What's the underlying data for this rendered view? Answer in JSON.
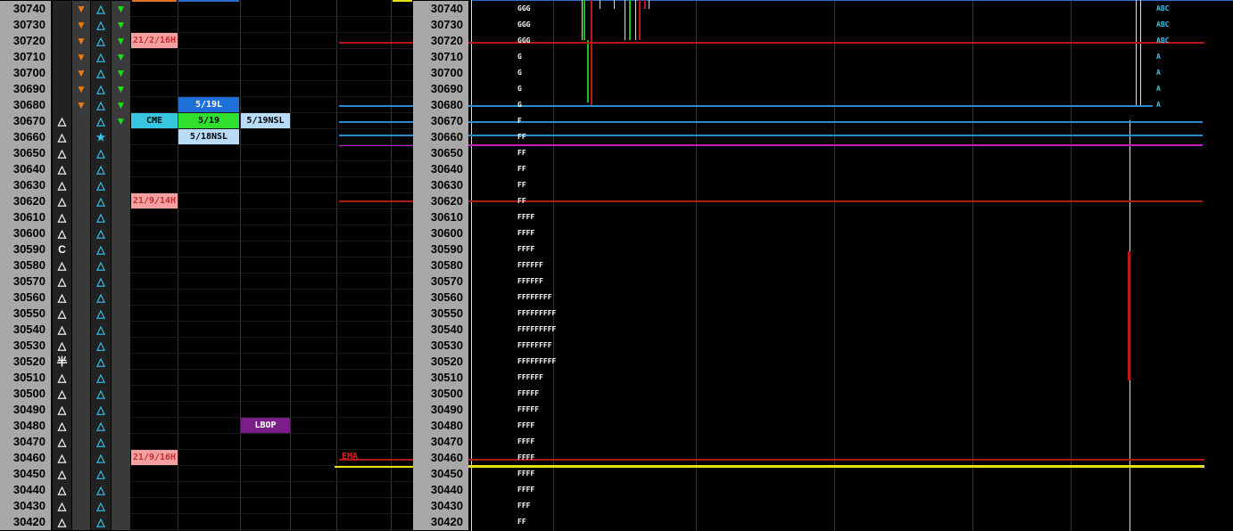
{
  "rows": [
    {
      "price": "30740",
      "left_icon": "",
      "left_color": "",
      "mid_icon": "▼",
      "mid_color": "#f07a12",
      "tri": "△",
      "tri_color": "#38c6f0",
      "right_icon": "▼",
      "right_color": "#19e01c",
      "tpo": "GGG",
      "abc": "ABC"
    },
    {
      "price": "30730",
      "left_icon": "",
      "left_color": "",
      "mid_icon": "▼",
      "mid_color": "#f07a12",
      "tri": "△",
      "tri_color": "#38c6f0",
      "right_icon": "▼",
      "right_color": "#19e01c",
      "tpo": "GGG",
      "abc": "ABC"
    },
    {
      "price": "30720",
      "left_icon": "",
      "left_color": "",
      "mid_icon": "▼",
      "mid_color": "#f07a12",
      "tri": "△",
      "tri_color": "#38c6f0",
      "right_icon": "▼",
      "right_color": "#19e01c",
      "tpo": "GGG",
      "abc": "ABC"
    },
    {
      "price": "30710",
      "left_icon": "",
      "left_color": "",
      "mid_icon": "▼",
      "mid_color": "#f07a12",
      "tri": "△",
      "tri_color": "#38c6f0",
      "right_icon": "▼",
      "right_color": "#19e01c",
      "tpo": "G",
      "abc": "A"
    },
    {
      "price": "30700",
      "left_icon": "",
      "left_color": "",
      "mid_icon": "▼",
      "mid_color": "#f07a12",
      "tri": "△",
      "tri_color": "#38c6f0",
      "right_icon": "▼",
      "right_color": "#19e01c",
      "tpo": "G",
      "abc": "A"
    },
    {
      "price": "30690",
      "left_icon": "",
      "left_color": "",
      "mid_icon": "▼",
      "mid_color": "#f07a12",
      "tri": "△",
      "tri_color": "#38c6f0",
      "right_icon": "▼",
      "right_color": "#19e01c",
      "tpo": "G",
      "abc": "A"
    },
    {
      "price": "30680",
      "left_icon": "",
      "left_color": "",
      "mid_icon": "▼",
      "mid_color": "#f07a12",
      "tri": "△",
      "tri_color": "#38c6f0",
      "right_icon": "▼",
      "right_color": "#19e01c",
      "tpo": "G",
      "abc": "A"
    },
    {
      "price": "30670",
      "left_icon": "△",
      "left_color": "#ffffff",
      "mid_icon": "",
      "mid_color": "",
      "tri": "△",
      "tri_color": "#38c6f0",
      "right_icon": "▼",
      "right_color": "#19e01c",
      "tpo": "F",
      "abc": ""
    },
    {
      "price": "30660",
      "left_icon": "△",
      "left_color": "#ffffff",
      "mid_icon": "",
      "mid_color": "",
      "tri": "★",
      "tri_color": "#38c6f0",
      "right_icon": "",
      "right_color": "",
      "tpo": "FF",
      "abc": ""
    },
    {
      "price": "30650",
      "left_icon": "△",
      "left_color": "#ffffff",
      "mid_icon": "",
      "mid_color": "",
      "tri": "△",
      "tri_color": "#38c6f0",
      "right_icon": "",
      "right_color": "",
      "tpo": "FF",
      "abc": ""
    },
    {
      "price": "30640",
      "left_icon": "△",
      "left_color": "#ffffff",
      "mid_icon": "",
      "mid_color": "",
      "tri": "△",
      "tri_color": "#38c6f0",
      "right_icon": "",
      "right_color": "",
      "tpo": "FF",
      "abc": ""
    },
    {
      "price": "30630",
      "left_icon": "△",
      "left_color": "#ffffff",
      "mid_icon": "",
      "mid_color": "",
      "tri": "△",
      "tri_color": "#38c6f0",
      "right_icon": "",
      "right_color": "",
      "tpo": "FF",
      "abc": ""
    },
    {
      "price": "30620",
      "left_icon": "△",
      "left_color": "#ffffff",
      "mid_icon": "",
      "mid_color": "",
      "tri": "△",
      "tri_color": "#38c6f0",
      "right_icon": "",
      "right_color": "",
      "tpo": "FF",
      "abc": ""
    },
    {
      "price": "30610",
      "left_icon": "△",
      "left_color": "#ffffff",
      "mid_icon": "",
      "mid_color": "",
      "tri": "△",
      "tri_color": "#38c6f0",
      "right_icon": "",
      "right_color": "",
      "tpo": "FFFF",
      "abc": ""
    },
    {
      "price": "30600",
      "left_icon": "△",
      "left_color": "#ffffff",
      "mid_icon": "",
      "mid_color": "",
      "tri": "△",
      "tri_color": "#38c6f0",
      "right_icon": "",
      "right_color": "",
      "tpo": "FFFF",
      "abc": ""
    },
    {
      "price": "30590",
      "left_icon": "C",
      "left_color": "#ffffff",
      "mid_icon": "",
      "mid_color": "",
      "tri": "△",
      "tri_color": "#38c6f0",
      "right_icon": "",
      "right_color": "",
      "tpo": "FFFF",
      "abc": ""
    },
    {
      "price": "30580",
      "left_icon": "△",
      "left_color": "#ffffff",
      "mid_icon": "",
      "mid_color": "",
      "tri": "△",
      "tri_color": "#38c6f0",
      "right_icon": "",
      "right_color": "",
      "tpo": "FFFFFF",
      "abc": ""
    },
    {
      "price": "30570",
      "left_icon": "△",
      "left_color": "#ffffff",
      "mid_icon": "",
      "mid_color": "",
      "tri": "△",
      "tri_color": "#38c6f0",
      "right_icon": "",
      "right_color": "",
      "tpo": "FFFFFF",
      "abc": ""
    },
    {
      "price": "30560",
      "left_icon": "△",
      "left_color": "#ffffff",
      "mid_icon": "",
      "mid_color": "",
      "tri": "△",
      "tri_color": "#38c6f0",
      "right_icon": "",
      "right_color": "",
      "tpo": "FFFFFFFF",
      "abc": ""
    },
    {
      "price": "30550",
      "left_icon": "△",
      "left_color": "#ffffff",
      "mid_icon": "",
      "mid_color": "",
      "tri": "△",
      "tri_color": "#38c6f0",
      "right_icon": "",
      "right_color": "",
      "tpo": "FFFFFFFFF",
      "abc": ""
    },
    {
      "price": "30540",
      "left_icon": "△",
      "left_color": "#ffffff",
      "mid_icon": "",
      "mid_color": "",
      "tri": "△",
      "tri_color": "#38c6f0",
      "right_icon": "",
      "right_color": "",
      "tpo": "FFFFFFFFF",
      "abc": ""
    },
    {
      "price": "30530",
      "left_icon": "△",
      "left_color": "#ffffff",
      "mid_icon": "",
      "mid_color": "",
      "tri": "△",
      "tri_color": "#38c6f0",
      "right_icon": "",
      "right_color": "",
      "tpo": "FFFFFFFF",
      "abc": ""
    },
    {
      "price": "30520",
      "left_icon": "半",
      "left_color": "#ffffff",
      "mid_icon": "",
      "mid_color": "",
      "tri": "△",
      "tri_color": "#38c6f0",
      "right_icon": "",
      "right_color": "",
      "tpo": "FFFFFFFFF",
      "abc": ""
    },
    {
      "price": "30510",
      "left_icon": "△",
      "left_color": "#ffffff",
      "mid_icon": "",
      "mid_color": "",
      "tri": "△",
      "tri_color": "#38c6f0",
      "right_icon": "",
      "right_color": "",
      "tpo": "FFFFFF",
      "abc": ""
    },
    {
      "price": "30500",
      "left_icon": "△",
      "left_color": "#ffffff",
      "mid_icon": "",
      "mid_color": "",
      "tri": "△",
      "tri_color": "#38c6f0",
      "right_icon": "",
      "right_color": "",
      "tpo": "FFFFF",
      "abc": ""
    },
    {
      "price": "30490",
      "left_icon": "△",
      "left_color": "#ffffff",
      "mid_icon": "",
      "mid_color": "",
      "tri": "△",
      "tri_color": "#38c6f0",
      "right_icon": "",
      "right_color": "",
      "tpo": "FFFFF",
      "abc": ""
    },
    {
      "price": "30480",
      "left_icon": "△",
      "left_color": "#ffffff",
      "mid_icon": "",
      "mid_color": "",
      "tri": "△",
      "tri_color": "#38c6f0",
      "right_icon": "",
      "right_color": "",
      "tpo": "FFFF",
      "abc": ""
    },
    {
      "price": "30470",
      "left_icon": "△",
      "left_color": "#ffffff",
      "mid_icon": "",
      "mid_color": "",
      "tri": "△",
      "tri_color": "#38c6f0",
      "right_icon": "",
      "right_color": "",
      "tpo": "FFFF",
      "abc": ""
    },
    {
      "price": "30460",
      "left_icon": "△",
      "left_color": "#ffffff",
      "mid_icon": "",
      "mid_color": "",
      "tri": "△",
      "tri_color": "#38c6f0",
      "right_icon": "",
      "right_color": "",
      "tpo": "FFFF",
      "abc": ""
    },
    {
      "price": "30450",
      "left_icon": "△",
      "left_color": "#ffffff",
      "mid_icon": "",
      "mid_color": "",
      "tri": "△",
      "tri_color": "#38c6f0",
      "right_icon": "",
      "right_color": "",
      "tpo": "FFFF",
      "abc": ""
    },
    {
      "price": "30440",
      "left_icon": "△",
      "left_color": "#ffffff",
      "mid_icon": "",
      "mid_color": "",
      "tri": "△",
      "tri_color": "#38c6f0",
      "right_icon": "",
      "right_color": "",
      "tpo": "FFFF",
      "abc": ""
    },
    {
      "price": "30430",
      "left_icon": "△",
      "left_color": "#ffffff",
      "mid_icon": "",
      "mid_color": "",
      "tri": "△",
      "tri_color": "#38c6f0",
      "right_icon": "",
      "right_color": "",
      "tpo": "FFF",
      "abc": ""
    },
    {
      "price": "30420",
      "left_icon": "△",
      "left_color": "#ffffff",
      "mid_icon": "",
      "mid_color": "",
      "tri": "△",
      "tri_color": "#38c6f0",
      "right_icon": "",
      "right_color": "",
      "tpo": "FF",
      "abc": ""
    }
  ],
  "tags": [
    {
      "name": "date-tag-21-2-16",
      "text": "21/2/16H",
      "row": 2,
      "col": "a",
      "bg": "#f4a0a0",
      "fg": "#c03030"
    },
    {
      "name": "date-tag-21-9-14",
      "text": "21/9/14H",
      "row": 12,
      "col": "a",
      "bg": "#f4a0a0",
      "fg": "#c03030"
    },
    {
      "name": "date-tag-21-9-16",
      "text": "21/9/16H",
      "row": 28,
      "col": "a",
      "bg": "#f4a0a0",
      "fg": "#c03030"
    },
    {
      "name": "cme-tag",
      "text": "CME",
      "row": 7,
      "col": "a",
      "bg": "#38c6e0",
      "fg": "#000000"
    },
    {
      "name": "tag-5-19l",
      "text": "5/19L",
      "row": 6,
      "col": "b",
      "bg": "#1e6fd8",
      "fg": "#ffffff"
    },
    {
      "name": "tag-5-19",
      "text": "5/19",
      "row": 7,
      "col": "b",
      "bg": "#2fe02f",
      "fg": "#000000"
    },
    {
      "name": "tag-5-18nsl",
      "text": "5/18NSL",
      "row": 8,
      "col": "b",
      "bg": "#b8dcf8",
      "fg": "#000000"
    },
    {
      "name": "tag-5-19nsl",
      "text": "5/19NSL",
      "row": 7,
      "col": "c",
      "bg": "#b8dcf8",
      "fg": "#000000"
    },
    {
      "name": "tag-lbop",
      "text": "LBOP",
      "row": 26,
      "col": "c",
      "bg": "#7a1e8a",
      "fg": "#ffffff"
    }
  ],
  "ema_label": "EMA",
  "colors": {
    "red_level": "#b01818",
    "blue_level": "#2a8ad0",
    "magenta_level": "#c020c0",
    "yellow_level": "#e8e010",
    "abc_color": "#38c6f0"
  }
}
